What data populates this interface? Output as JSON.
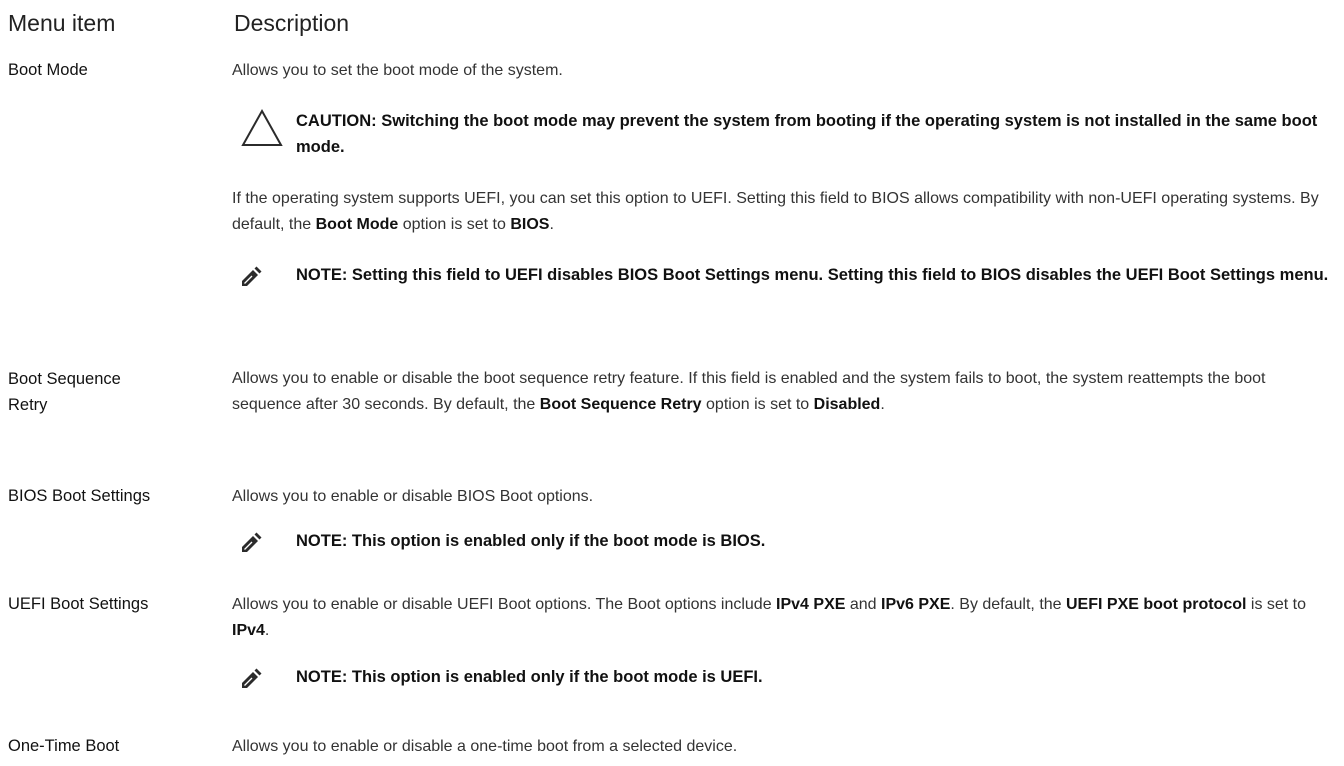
{
  "header": {
    "menu_item": "Menu item",
    "description": "Description"
  },
  "rows": [
    {
      "name": "Boot Mode",
      "description": "Allows you to set the boot mode of the system.",
      "caution": "CAUTION: Switching the boot mode may prevent the system from booting if the operating system is not installed in the same boot mode.",
      "para": {
        "t1": "If the operating system supports UEFI, you can set this option to UEFI. Setting this field to BIOS allows compatibility with non-UEFI operating systems. By default, the ",
        "b1": "Boot Mode",
        "t2": " option is set to ",
        "b2": "BIOS",
        "t3": "."
      },
      "note": "NOTE: Setting this field to UEFI disables BIOS Boot Settings menu. Setting this field to BIOS disables the UEFI Boot Settings menu."
    },
    {
      "name_line1": "Boot Sequence",
      "name_line2": "Retry",
      "desc": {
        "t1": "Allows you to enable or disable the boot sequence retry feature. If this field is enabled and the system fails to boot, the system reattempts the boot sequence after 30 seconds. By default, the ",
        "b1": "Boot Sequence Retry",
        "t2": " option is set to ",
        "b2": "Disabled",
        "t3": "."
      }
    },
    {
      "name": "BIOS Boot Settings",
      "description": "Allows you to enable or disable BIOS Boot options.",
      "note": "NOTE: This option is enabled only if the boot mode is BIOS."
    },
    {
      "name": "UEFI Boot Settings",
      "desc": {
        "t1": "Allows you to enable or disable UEFI Boot options. The Boot options include ",
        "b1": "IPv4 PXE",
        "t2": " and ",
        "b2": "IPv6 PXE",
        "t3": ". By default, the ",
        "b3": "UEFI PXE boot protocol",
        "t4": " is set to ",
        "b4": "IPv4",
        "t5": "."
      },
      "note": "NOTE: This option is enabled only if the boot mode is UEFI."
    },
    {
      "name": "One-Time Boot",
      "description": "Allows you to enable or disable a one-time boot from a selected device."
    }
  ],
  "icons": {
    "caution": "caution-triangle-icon",
    "note": "note-pencil-icon"
  },
  "colors": {
    "text": "#333333",
    "bold": "#111111",
    "icon": "#2b2b2b"
  }
}
